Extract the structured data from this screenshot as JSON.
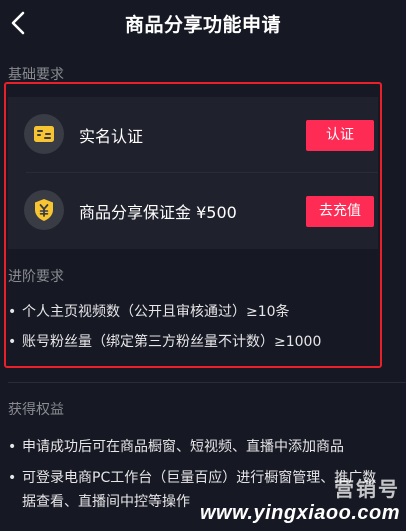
{
  "header": {
    "title": "商品分享功能申请",
    "back_icon": "chevron-left-icon"
  },
  "basic": {
    "label": "基础要求",
    "items": [
      {
        "icon": "id-card-icon",
        "label": "实名认证",
        "button": "认证"
      },
      {
        "icon": "yuan-shield-icon",
        "label": "商品分享保证金 ¥500",
        "button": "去充值"
      }
    ]
  },
  "advanced": {
    "label": "进阶要求",
    "bullets": [
      "个人主页视频数（公开且审核通过）≥10条",
      "账号粉丝量（绑定第三方粉丝量不计数）≥1000"
    ]
  },
  "benefits": {
    "label": "获得权益",
    "bullets": [
      {
        "line1": "申请成功后可在商品橱窗、短视频、直播中添加商品",
        "line2": ""
      },
      {
        "line1": "可登录电商PC工作台（巨量百应）进行橱窗管理、推广数",
        "line2": "据查看、直播间中控等操作"
      }
    ]
  },
  "watermark": {
    "logo": "营销号",
    "url": "www.yingxiaoo.com"
  },
  "colors": {
    "background": "#161823",
    "card": "#1f212c",
    "accent": "#fe2c55",
    "icon_yellow": "#f7c531",
    "highlight_border": "#e8202a"
  }
}
